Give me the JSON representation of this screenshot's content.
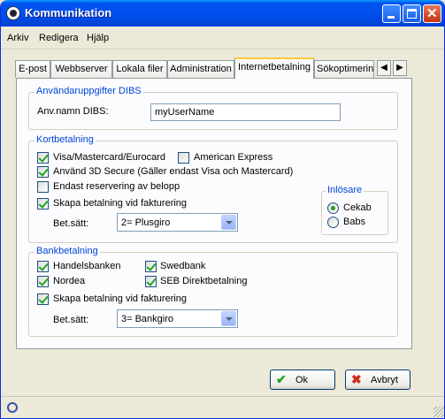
{
  "window": {
    "title": "Kommunikation",
    "icon": "app-icon"
  },
  "menu": [
    "Arkiv",
    "Redigera",
    "Hjälp"
  ],
  "tabs": [
    "E-post",
    "Webbserver",
    "Lokala filer",
    "Administration",
    "Internetbetalning",
    "Sökoptimering"
  ],
  "active_tab": "Internetbetalning",
  "dibs": {
    "group_title": "Användaruppgifter DIBS",
    "username_label": "Anv.namn DIBS:",
    "username_value": "myUserName"
  },
  "card": {
    "group_title": "Kortbetalning",
    "visa": {
      "label": "Visa/Mastercard/Eurocard",
      "checked": true
    },
    "amex": {
      "label": "American Express",
      "checked": false
    },
    "secure3d": {
      "label": "Använd 3D Secure (Gäller endast Visa och Mastercard)",
      "checked": true
    },
    "reserve": {
      "label": "Endast reservering av belopp",
      "checked": false
    },
    "create_payment": {
      "label": "Skapa betalning vid fakturering",
      "checked": true
    },
    "bet_label": "Bet.sätt:",
    "bet_value": "2= Plusgiro",
    "acquirer": {
      "title": "Inlösare",
      "options": [
        "Cekab",
        "Babs"
      ],
      "selected": "Cekab"
    }
  },
  "bank": {
    "group_title": "Bankbetalning",
    "handelsbanken": {
      "label": "Handelsbanken",
      "checked": true
    },
    "swedbank": {
      "label": "Swedbank",
      "checked": true
    },
    "nordea": {
      "label": "Nordea",
      "checked": true
    },
    "seb": {
      "label": "SEB Direktbetalning",
      "checked": true
    },
    "create_payment": {
      "label": "Skapa betalning vid fakturering",
      "checked": true
    },
    "bet_label": "Bet.sätt:",
    "bet_value": "3= Bankgiro"
  },
  "buttons": {
    "ok": "Ok",
    "cancel": "Avbryt"
  },
  "colors": {
    "titlebar": "#0053ee",
    "group_title": "#0046d5",
    "check": "#21a121",
    "cancel_icon": "#d22d1c"
  }
}
